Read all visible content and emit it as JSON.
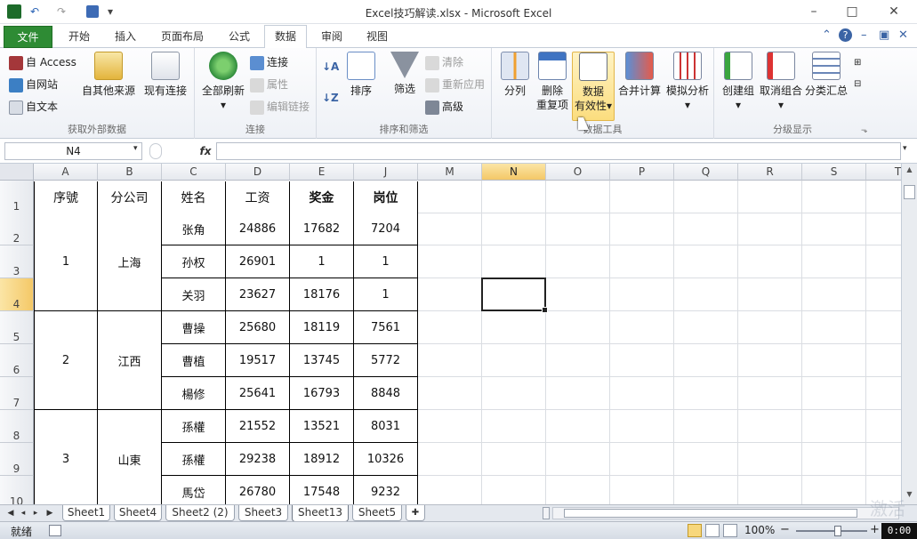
{
  "window": {
    "title": "Excel技巧解读.xlsx - Microsoft Excel",
    "min_glyph": "–",
    "max_glyph": "□",
    "close_glyph": "✕"
  },
  "qat": {
    "save_icon": "save-icon",
    "undo_icon": "undo-icon",
    "redo_icon": "redo-icon",
    "undo_glyph": "↶",
    "redo_glyph": "↷",
    "dropdown": "▾"
  },
  "tabs": [
    {
      "label": "文件"
    },
    {
      "label": "开始"
    },
    {
      "label": "插入"
    },
    {
      "label": "页面布局"
    },
    {
      "label": "公式"
    },
    {
      "label": "数据"
    },
    {
      "label": "审阅"
    },
    {
      "label": "视图"
    }
  ],
  "ribbon": {
    "external": {
      "access": "自 Access",
      "web": "自网站",
      "text": "自文本",
      "other": "自其他来源",
      "existing": "现有连接",
      "label": "获取外部数据"
    },
    "connections": {
      "refresh": "全部刷新",
      "connect": "连接",
      "props": "属性",
      "edit": "编辑链接",
      "label": "连接"
    },
    "sort": {
      "sort": "排序",
      "filter": "筛选",
      "clear": "清除",
      "reapply": "重新应用",
      "advanced": "高级",
      "label": "排序和筛选"
    },
    "tools": {
      "split": "分列",
      "dedupe_1": "删除",
      "dedupe_2": "重复项",
      "valid_1": "数据",
      "valid_2": "有效性",
      "merge": "合并计算",
      "whatif": "模拟分析",
      "label": "数据工具"
    },
    "outline": {
      "group": "创建组",
      "ungroup": "取消组合",
      "subtotal": "分类汇总",
      "label": "分级显示"
    }
  },
  "formula_bar": {
    "name_box": "N4",
    "fx": "fx",
    "value": ""
  },
  "columns": [
    "A",
    "B",
    "C",
    "D",
    "E",
    "J",
    "M",
    "N",
    "O",
    "P",
    "Q",
    "R",
    "S",
    "T"
  ],
  "rows": [
    "1",
    "2",
    "3",
    "4",
    "5",
    "6",
    "7",
    "8",
    "9",
    "10"
  ],
  "selected_cell": "N4",
  "table": {
    "headers": [
      "序號",
      "分公司",
      "姓名",
      "工资",
      "奖金",
      "岗位"
    ],
    "groups": [
      {
        "id": "1",
        "branch": "上海"
      },
      {
        "id": "2",
        "branch": "江西"
      },
      {
        "id": "3",
        "branch": "山東"
      }
    ],
    "records": [
      {
        "name": "张角",
        "salary": "24886",
        "bonus": "17682",
        "post": "7204"
      },
      {
        "name": "孙权",
        "salary": "26901",
        "bonus": "1",
        "post": "1"
      },
      {
        "name": "关羽",
        "salary": "23627",
        "bonus": "18176",
        "post": "1"
      },
      {
        "name": "曹操",
        "salary": "25680",
        "bonus": "18119",
        "post": "7561"
      },
      {
        "name": "曹植",
        "salary": "19517",
        "bonus": "13745",
        "post": "5772"
      },
      {
        "name": "楊修",
        "salary": "25641",
        "bonus": "16793",
        "post": "8848"
      },
      {
        "name": "孫權",
        "salary": "21552",
        "bonus": "13521",
        "post": "8031"
      },
      {
        "name": "孫權",
        "salary": "29238",
        "bonus": "18912",
        "post": "10326"
      },
      {
        "name": "馬岱",
        "salary": "26780",
        "bonus": "17548",
        "post": "9232"
      }
    ]
  },
  "sheets": [
    "Sheet1",
    "Sheet4",
    "Sheet2 (2)",
    "Sheet3",
    "Sheet13",
    "Sheet5"
  ],
  "active_sheet": "Sheet13",
  "sheet_nav": {
    "first": "◀",
    "prev": "◂",
    "next": "▸",
    "last": "▶"
  },
  "status": {
    "ready": "就绪",
    "zoom": "100%",
    "zoom_minus": "−",
    "zoom_plus": "+",
    "clock": "0:00"
  },
  "watermark": "激活"
}
